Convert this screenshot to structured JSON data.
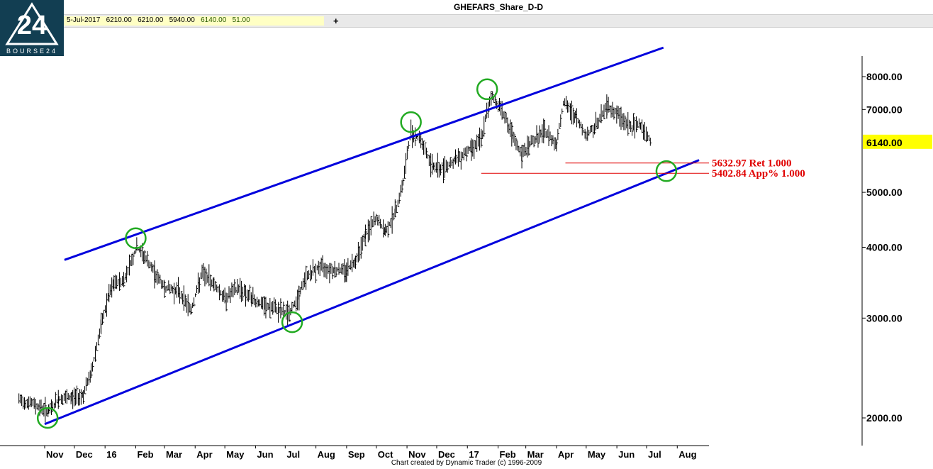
{
  "logo": {
    "text": "BOURSE24",
    "colors": {
      "background": "#123e52",
      "mark": "#ffffff"
    }
  },
  "header": {
    "title": "GHEFARS_Share_D-D"
  },
  "databar": {
    "date": "5-Jul-2017",
    "open": "6210.00",
    "high": "6210.00",
    "low": "5940.00",
    "close": "6140.00",
    "volume": "51.00",
    "add_symbol": "+"
  },
  "footer": {
    "credit": "Chart created by Dynamic Trader  (c) 1996-2009"
  },
  "chart_data": {
    "type": "bar",
    "title": "GHEFARS_Share_D-D",
    "scale": "log",
    "ylim": [
      1800,
      9000
    ],
    "yticks": [
      "8000.00",
      "7000.00",
      "5000.00",
      "4000.00",
      "3000.00",
      "2000.00"
    ],
    "ytick_values": [
      8000,
      7000,
      5000,
      4000,
      3000,
      2000
    ],
    "xticks": [
      "Nov",
      "Dec",
      "16",
      "Feb",
      "Mar",
      "Apr",
      "May",
      "Jun",
      "Jul",
      "Aug",
      "Sep",
      "Oct",
      "Nov",
      "Dec",
      "17",
      "Feb",
      "Mar",
      "Apr",
      "May",
      "Jun",
      "Jul",
      "Aug"
    ],
    "xtick_dates": [
      "2015-11-01",
      "2015-12-01",
      "2016-01-01",
      "2016-02-01",
      "2016-03-01",
      "2016-04-01",
      "2016-05-01",
      "2016-06-01",
      "2016-07-01",
      "2016-08-01",
      "2016-09-01",
      "2016-10-01",
      "2016-11-01",
      "2016-12-01",
      "2017-01-01",
      "2017-02-01",
      "2017-03-01",
      "2017-04-01",
      "2017-05-01",
      "2017-06-01",
      "2017-07-01",
      "2017-08-01"
    ],
    "last_price": {
      "label": "6140.00",
      "value": 6140,
      "color": "#ffff00"
    },
    "price_path": [
      [
        "2015-10-06",
        2150
      ],
      [
        "2015-10-20",
        2120
      ],
      [
        "2015-11-05",
        2050
      ],
      [
        "2015-11-15",
        2160
      ],
      [
        "2015-11-28",
        2170
      ],
      [
        "2015-12-10",
        2200
      ],
      [
        "2015-12-18",
        2400
      ],
      [
        "2015-12-28",
        2900
      ],
      [
        "2016-01-05",
        3300
      ],
      [
        "2016-01-10",
        3450
      ],
      [
        "2016-01-20",
        3500
      ],
      [
        "2016-01-28",
        3800
      ],
      [
        "2016-02-02",
        4000
      ],
      [
        "2016-02-10",
        3850
      ],
      [
        "2016-02-20",
        3600
      ],
      [
        "2016-03-01",
        3400
      ],
      [
        "2016-03-15",
        3350
      ],
      [
        "2016-03-28",
        3100
      ],
      [
        "2016-04-08",
        3600
      ],
      [
        "2016-04-20",
        3450
      ],
      [
        "2016-05-01",
        3250
      ],
      [
        "2016-05-15",
        3400
      ],
      [
        "2016-05-28",
        3250
      ],
      [
        "2016-06-10",
        3150
      ],
      [
        "2016-06-25",
        3100
      ],
      [
        "2016-07-05",
        3050
      ],
      [
        "2016-07-15",
        3300
      ],
      [
        "2016-07-22",
        3550
      ],
      [
        "2016-08-05",
        3700
      ],
      [
        "2016-08-20",
        3650
      ],
      [
        "2016-09-01",
        3650
      ],
      [
        "2016-09-10",
        3800
      ],
      [
        "2016-09-20",
        4200
      ],
      [
        "2016-10-01",
        4500
      ],
      [
        "2016-10-10",
        4250
      ],
      [
        "2016-10-20",
        4600
      ],
      [
        "2016-10-28",
        5200
      ],
      [
        "2016-11-05",
        6400
      ],
      [
        "2016-11-15",
        6200
      ],
      [
        "2016-11-25",
        5600
      ],
      [
        "2016-12-05",
        5500
      ],
      [
        "2016-12-20",
        5700
      ],
      [
        "2017-01-05",
        6000
      ],
      [
        "2017-01-15",
        6200
      ],
      [
        "2017-01-25",
        7400
      ],
      [
        "2017-02-05",
        7000
      ],
      [
        "2017-02-15",
        6300
      ],
      [
        "2017-02-25",
        5800
      ],
      [
        "2017-03-05",
        6100
      ],
      [
        "2017-03-20",
        6400
      ],
      [
        "2017-04-01",
        6100
      ],
      [
        "2017-04-08",
        7200
      ],
      [
        "2017-04-20",
        6800
      ],
      [
        "2017-05-01",
        6300
      ],
      [
        "2017-05-12",
        6600
      ],
      [
        "2017-05-22",
        7100
      ],
      [
        "2017-06-01",
        6900
      ],
      [
        "2017-06-15",
        6500
      ],
      [
        "2017-06-25",
        6600
      ],
      [
        "2017-07-05",
        6140
      ]
    ],
    "channel_lines": [
      {
        "name": "upper",
        "points": [
          [
            "2015-11-21",
            3800
          ],
          [
            "2017-07-18",
            9000
          ]
        ],
        "color": "#0000dd"
      },
      {
        "name": "lower",
        "points": [
          [
            "2015-11-01",
            1950
          ],
          [
            "2017-08-23",
            5700
          ]
        ],
        "color": "#0000dd"
      }
    ],
    "pivot_circles": [
      {
        "date": "2015-11-04",
        "value": 2000
      },
      {
        "date": "2016-02-01",
        "value": 4150
      },
      {
        "date": "2016-07-08",
        "value": 2950
      },
      {
        "date": "2016-11-05",
        "value": 6650
      },
      {
        "date": "2017-01-21",
        "value": 7600
      },
      {
        "date": "2017-07-21",
        "value": 5450
      }
    ],
    "levels": [
      {
        "label": "5632.97 Ret 1.000",
        "value": 5632.97,
        "from": "2017-04-10",
        "to": "2017-08-20",
        "color": "#e00000"
      },
      {
        "label": "5402.84 App% 1.000",
        "value": 5402.84,
        "from": "2017-01-15",
        "to": "2017-08-20",
        "color": "#e00000"
      }
    ]
  }
}
